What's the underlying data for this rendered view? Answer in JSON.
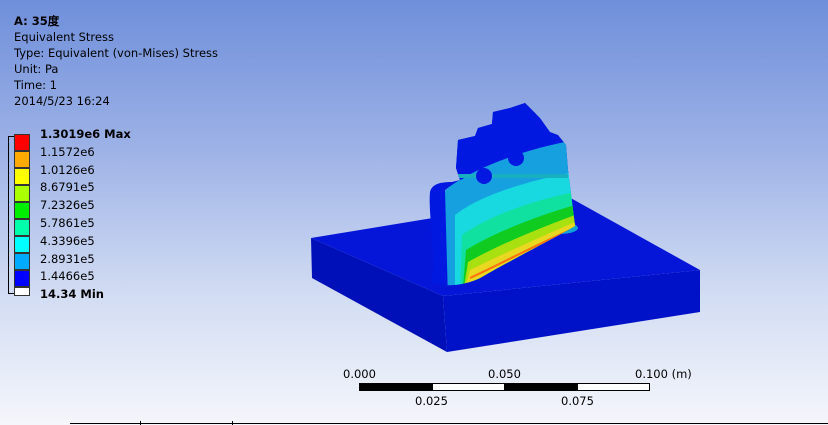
{
  "header": {
    "title": "A: 35度",
    "result": "Equivalent Stress",
    "type": "Type: Equivalent (von-Mises) Stress",
    "unit": "Unit: Pa",
    "time": "Time: 1",
    "date": "2014/5/23 16:24"
  },
  "legend": {
    "labels": [
      "1.3019e6 Max",
      "1.1572e6",
      "1.0126e6",
      "8.6791e5",
      "7.2326e5",
      "5.7861e5",
      "4.3396e5",
      "2.8931e5",
      "1.4466e5",
      "14.34 Min"
    ],
    "colors": [
      "#ff0000",
      "#ffaa00",
      "#ffff00",
      "#aaff00",
      "#00ee00",
      "#00ffaa",
      "#00ffff",
      "#00aaff",
      "#0000ff",
      "#ffffff"
    ]
  },
  "scale_bar": {
    "top_labels": [
      "0.000",
      "0.050",
      "0.100 (m)"
    ],
    "bottom_labels": [
      "0.025",
      "0.075"
    ]
  }
}
